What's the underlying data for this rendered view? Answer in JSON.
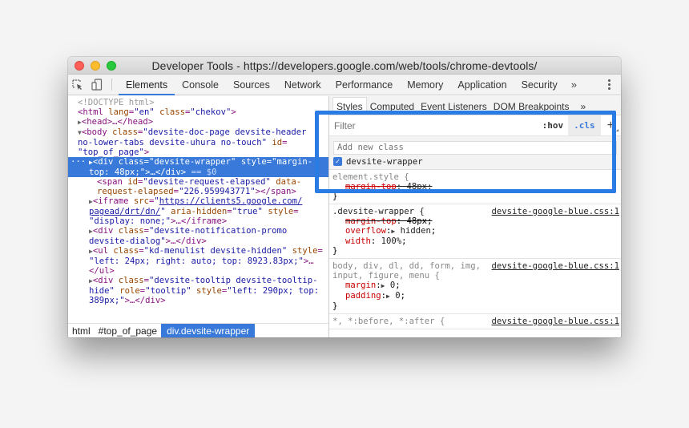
{
  "window": {
    "title": "Developer Tools - https://developers.google.com/web/tools/chrome-devtools/"
  },
  "toolbar": {
    "tabs": [
      "Elements",
      "Console",
      "Sources",
      "Network",
      "Performance",
      "Memory",
      "Application",
      "Security"
    ],
    "active_tab": "Elements",
    "more": "»"
  },
  "dom": {
    "doctype": "<!DOCTYPE html>",
    "html_tag": "html",
    "html_lang_attr": "lang",
    "html_lang_val": "\"en\"",
    "html_class_attr": "class",
    "html_class_val": "\"chekov\"",
    "head": "<head>…</head>",
    "body_class_val_1": "\"devsite-doc-page devsite-header",
    "body_class_val_2": "no-lower-tabs devsite-uhura no-touch\"",
    "body_id_val": "\"top_of_page\"",
    "sel_line1_val": "\"devsite-wrapper\"",
    "sel_line1_style": "\"margin-",
    "sel_line2": "top: 48px;\">…</div>",
    "sel_eq": " == $0",
    "span_id_val": "\"devsite-request-elapsed\"",
    "span_data_attr": "data-",
    "span_data_attr2": "request-elapsed",
    "span_data_val": "\"226.959943771\"",
    "iframe_src_1": "https://clients5.google.com/",
    "iframe_src_2": "pagead/drt/dn/",
    "iframe_aria_val": "\"true\"",
    "iframe_style_val": "\"display: none;\"",
    "promo_class_1": "\"devsite-notification-promo",
    "promo_class_2": "devsite-dialog\"",
    "ul_class_val": "\"kd-menulist devsite-hidden\"",
    "ul_style_val": "\"left: 24px; right: auto; top: 8923.83px;\"",
    "tooltip_class_1": "\"devsite-tooltip devsite-tooltip-",
    "tooltip_class_2": "hide\"",
    "tooltip_role_val": "\"tooltip\"",
    "tooltip_style_1": "\"left: 290px; top:",
    "tooltip_style_2": "389px;\""
  },
  "breadcrumbs": [
    "html",
    "#top_of_page",
    "div.devsite-wrapper"
  ],
  "sidebar": {
    "tabs": [
      "Styles",
      "Computed",
      "Event Listeners",
      "DOM Breakpoints"
    ],
    "active_tab": "Styles",
    "more": "»",
    "filter_placeholder": "Filter",
    "hov_label": ":hov",
    "cls_label": ".cls",
    "plus_label": "+",
    "add_class_placeholder": "Add new class",
    "classes": [
      {
        "name": "devsite-wrapper",
        "checked": true
      }
    ]
  },
  "rules": [
    {
      "selector": "element.style {",
      "source": "",
      "props": [
        {
          "name": "margin-top",
          "value": "48px",
          "struck": true
        }
      ]
    },
    {
      "selector": ".devsite-wrapper {",
      "source": "devsite-google-blue.css:1",
      "props": [
        {
          "name": "margin-top",
          "value": "48px",
          "struck": true
        },
        {
          "name": "overflow",
          "value": "hidden",
          "expand": true
        },
        {
          "name": "width",
          "value": "100%"
        }
      ]
    },
    {
      "selector_1": "body, div, dl, dd, form, img,",
      "selector_2": "input, figure, menu {",
      "source": "devsite-google-blue.css:1",
      "props": [
        {
          "name": "margin",
          "value": "0",
          "expand": true
        },
        {
          "name": "padding",
          "value": "0",
          "expand": true
        }
      ]
    },
    {
      "selector": "*, *:before, *:after {",
      "source": "devsite-google-blue.css:1"
    }
  ],
  "highlight_color": "#2b7be5",
  "accent_color": "#3879d9"
}
